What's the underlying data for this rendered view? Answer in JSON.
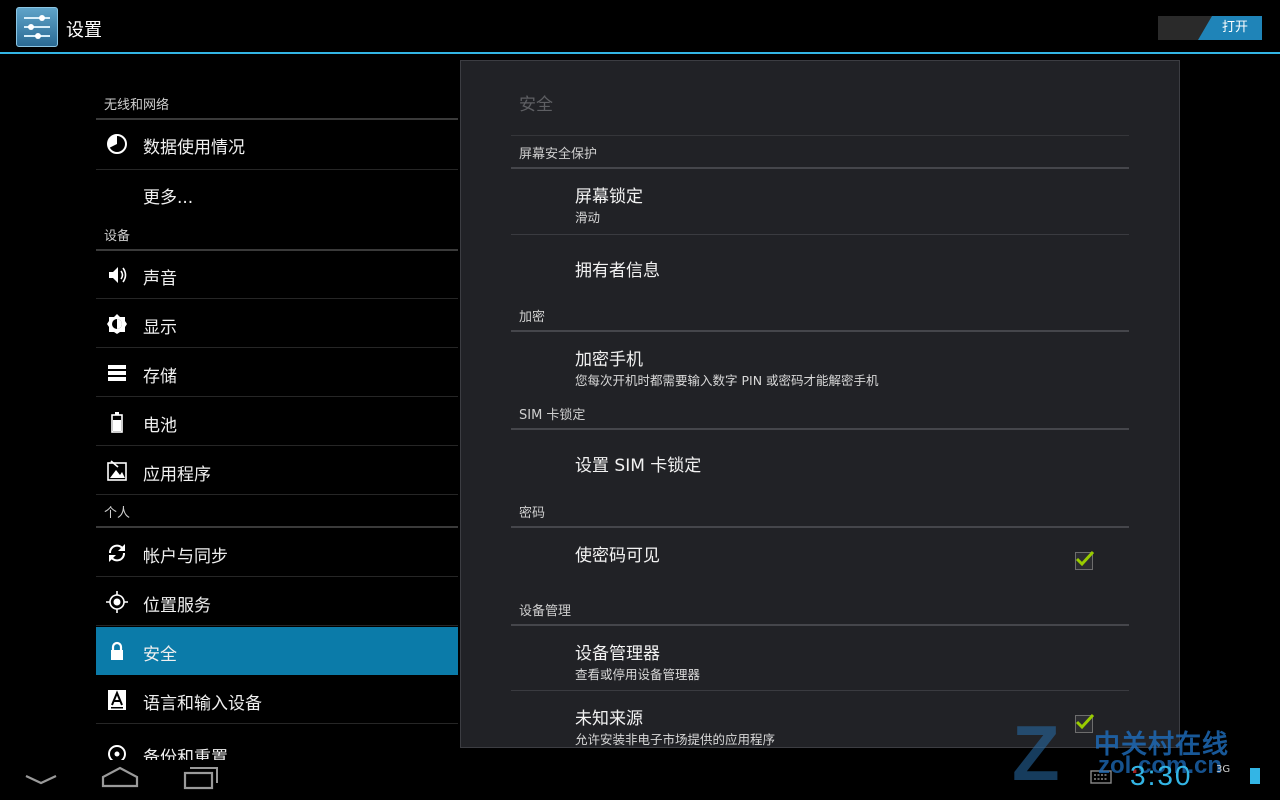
{
  "app": {
    "title": "设置",
    "toggle_label": "打开"
  },
  "sidebar": {
    "categories": [
      "无线和网络",
      "设备",
      "个人"
    ],
    "items": [
      {
        "label": "数据使用情况",
        "icon": "data-usage-icon"
      },
      {
        "label": "更多...",
        "icon": ""
      },
      {
        "label": "声音",
        "icon": "volume-icon"
      },
      {
        "label": "显示",
        "icon": "brightness-icon"
      },
      {
        "label": "存储",
        "icon": "storage-icon"
      },
      {
        "label": "电池",
        "icon": "battery-icon"
      },
      {
        "label": "应用程序",
        "icon": "apps-icon"
      },
      {
        "label": "帐户与同步",
        "icon": "sync-icon"
      },
      {
        "label": "位置服务",
        "icon": "location-icon"
      },
      {
        "label": "安全",
        "icon": "lock-icon",
        "selected": true
      },
      {
        "label": "语言和输入设备",
        "icon": "language-icon"
      },
      {
        "label": "备份和重置",
        "icon": "backup-icon"
      }
    ]
  },
  "panel": {
    "title": "安全",
    "sections": [
      {
        "header": "屏幕安全保护",
        "items": [
          {
            "title": "屏幕锁定",
            "summary": "滑动"
          },
          {
            "title": "拥有者信息"
          }
        ]
      },
      {
        "header": "加密",
        "items": [
          {
            "title": "加密手机",
            "summary": "您每次开机时都需要输入数字 PIN 或密码才能解密手机"
          }
        ]
      },
      {
        "header": "SIM 卡锁定",
        "items": [
          {
            "title": "设置 SIM 卡锁定"
          }
        ]
      },
      {
        "header": "密码",
        "items": [
          {
            "title": "使密码可见",
            "checked": true
          }
        ]
      },
      {
        "header": "设备管理",
        "items": [
          {
            "title": "设备管理器",
            "summary": "查看或停用设备管理器"
          },
          {
            "title": "未知来源",
            "summary": "允许安装非电子市场提供的应用程序",
            "checked": true
          }
        ]
      }
    ]
  },
  "status": {
    "time": "3:30",
    "signal": "3G"
  },
  "watermark": {
    "cn": "中关村在线",
    "site_a": "zol",
    "site_dot": ".",
    "site_b": "com.cn"
  },
  "colors": {
    "accent": "#33b5e5",
    "selected": "#0b7ba9",
    "check": "#99cc00"
  }
}
